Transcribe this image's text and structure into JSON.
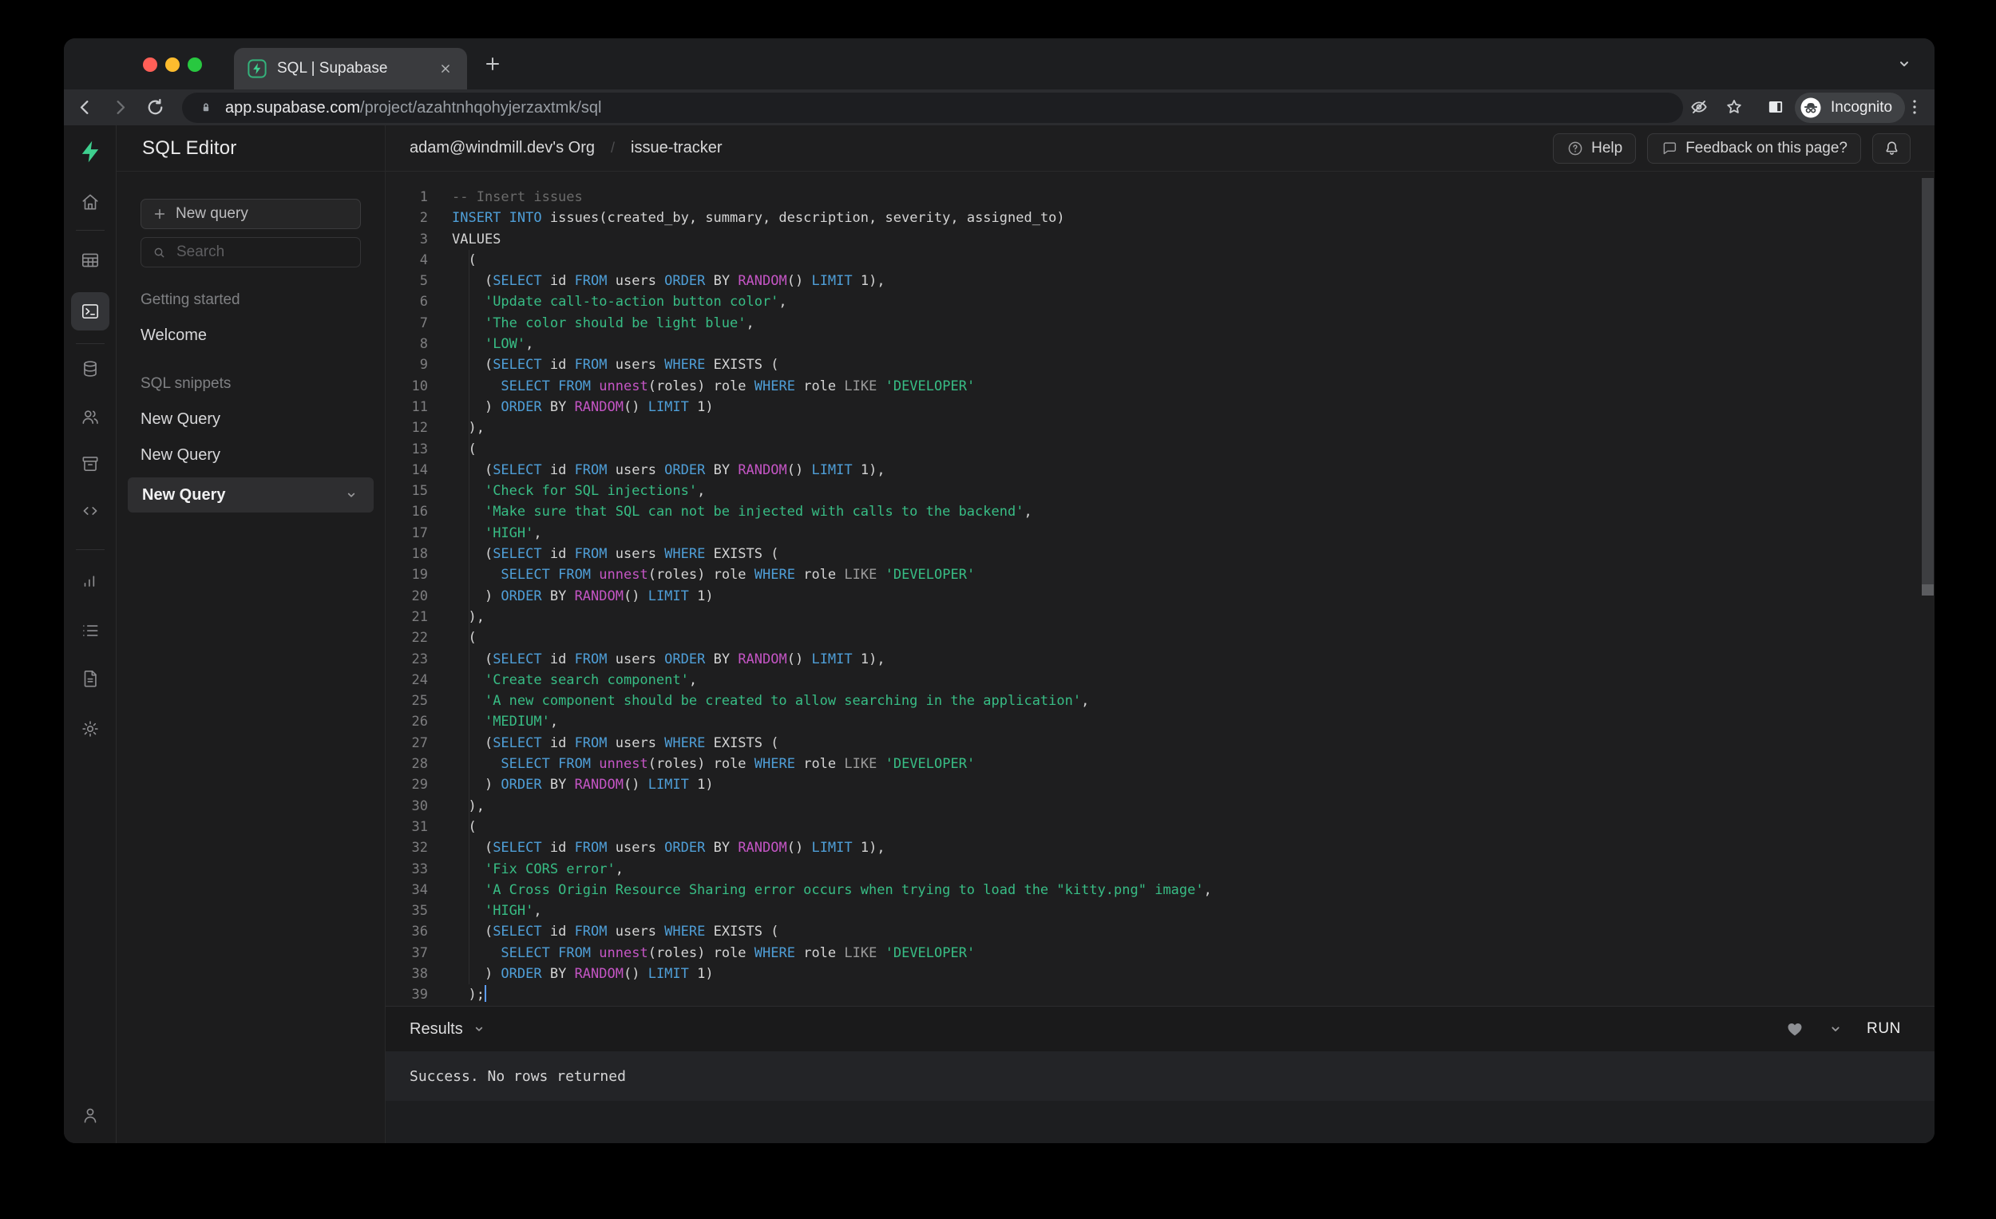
{
  "browser": {
    "tab_title": "SQL | Supabase",
    "url_host": "app.supabase.com",
    "url_path": "/project/azahtnhqohyjerzaxtmk/sql",
    "incognito_label": "Incognito"
  },
  "rail": {
    "items": [
      {
        "icon": "supabase-logo"
      },
      {
        "icon": "home"
      },
      {
        "divider": true
      },
      {
        "icon": "table-editor"
      },
      {
        "icon": "sql-editor",
        "active": true
      },
      {
        "divider": true
      },
      {
        "icon": "database"
      },
      {
        "icon": "auth-users"
      },
      {
        "icon": "storage"
      },
      {
        "icon": "edge-functions"
      },
      {
        "divider": true
      },
      {
        "icon": "reports"
      },
      {
        "icon": "logs"
      },
      {
        "icon": "api-docs"
      },
      {
        "icon": "settings"
      }
    ],
    "bottom": {
      "icon": "account"
    }
  },
  "panel": {
    "title": "SQL Editor",
    "new_query_button": "New query",
    "search_placeholder": "Search",
    "sections": [
      {
        "label": "Getting started",
        "items": [
          {
            "label": "Welcome",
            "active": false
          }
        ]
      },
      {
        "label": "SQL snippets",
        "items": [
          {
            "label": "New Query",
            "active": false
          },
          {
            "label": "New Query",
            "active": false
          },
          {
            "label": "New Query",
            "active": true
          }
        ]
      }
    ]
  },
  "header": {
    "breadcrumb_org": "adam@windmill.dev's Org",
    "breadcrumb_separator": "/",
    "breadcrumb_project": "issue-tracker",
    "help_button": "Help",
    "feedback_button": "Feedback on this page?"
  },
  "editor": {
    "cursor_line": 39,
    "lines": [
      [
        [
          "c",
          "-- Insert issues"
        ]
      ],
      [
        [
          "k",
          "INSERT"
        ],
        [
          "p",
          " "
        ],
        [
          "k",
          "INTO"
        ],
        [
          "p",
          " issues(created_by, summary, description, severity, assigned_to)"
        ]
      ],
      [
        [
          "p",
          "VALUES"
        ]
      ],
      [
        [
          "p",
          "  ("
        ]
      ],
      [
        [
          "p",
          "    ("
        ],
        [
          "k",
          "SELECT"
        ],
        [
          "p",
          " id "
        ],
        [
          "k",
          "FROM"
        ],
        [
          "p",
          " users "
        ],
        [
          "k",
          "ORDER"
        ],
        [
          "p",
          " BY "
        ],
        [
          "f",
          "RANDOM"
        ],
        [
          "p",
          "() "
        ],
        [
          "k",
          "LIMIT"
        ],
        [
          "p",
          " 1),"
        ]
      ],
      [
        [
          "p",
          "    "
        ],
        [
          "s",
          "'Update call-to-action button color'"
        ],
        [
          "p",
          ","
        ]
      ],
      [
        [
          "p",
          "    "
        ],
        [
          "s",
          "'The color should be light blue'"
        ],
        [
          "p",
          ","
        ]
      ],
      [
        [
          "p",
          "    "
        ],
        [
          "s",
          "'LOW'"
        ],
        [
          "p",
          ","
        ]
      ],
      [
        [
          "p",
          "    ("
        ],
        [
          "k",
          "SELECT"
        ],
        [
          "p",
          " id "
        ],
        [
          "k",
          "FROM"
        ],
        [
          "p",
          " users "
        ],
        [
          "k",
          "WHERE"
        ],
        [
          "p",
          " EXISTS ("
        ]
      ],
      [
        [
          "p",
          "      "
        ],
        [
          "k",
          "SELECT"
        ],
        [
          "p",
          " "
        ],
        [
          "k",
          "FROM"
        ],
        [
          "p",
          " "
        ],
        [
          "f",
          "unnest"
        ],
        [
          "p",
          "(roles) role "
        ],
        [
          "k",
          "WHERE"
        ],
        [
          "p",
          " role "
        ],
        [
          "o",
          "LIKE"
        ],
        [
          "p",
          " "
        ],
        [
          "s",
          "'DEVELOPER'"
        ]
      ],
      [
        [
          "p",
          "    ) "
        ],
        [
          "k",
          "ORDER"
        ],
        [
          "p",
          " BY "
        ],
        [
          "f",
          "RANDOM"
        ],
        [
          "p",
          "() "
        ],
        [
          "k",
          "LIMIT"
        ],
        [
          "p",
          " 1)"
        ]
      ],
      [
        [
          "p",
          "  ),"
        ]
      ],
      [
        [
          "p",
          "  ("
        ]
      ],
      [
        [
          "p",
          "    ("
        ],
        [
          "k",
          "SELECT"
        ],
        [
          "p",
          " id "
        ],
        [
          "k",
          "FROM"
        ],
        [
          "p",
          " users "
        ],
        [
          "k",
          "ORDER"
        ],
        [
          "p",
          " BY "
        ],
        [
          "f",
          "RANDOM"
        ],
        [
          "p",
          "() "
        ],
        [
          "k",
          "LIMIT"
        ],
        [
          "p",
          " 1),"
        ]
      ],
      [
        [
          "p",
          "    "
        ],
        [
          "s",
          "'Check for SQL injections'"
        ],
        [
          "p",
          ","
        ]
      ],
      [
        [
          "p",
          "    "
        ],
        [
          "s",
          "'Make sure that SQL can not be injected with calls to the backend'"
        ],
        [
          "p",
          ","
        ]
      ],
      [
        [
          "p",
          "    "
        ],
        [
          "s",
          "'HIGH'"
        ],
        [
          "p",
          ","
        ]
      ],
      [
        [
          "p",
          "    ("
        ],
        [
          "k",
          "SELECT"
        ],
        [
          "p",
          " id "
        ],
        [
          "k",
          "FROM"
        ],
        [
          "p",
          " users "
        ],
        [
          "k",
          "WHERE"
        ],
        [
          "p",
          " EXISTS ("
        ]
      ],
      [
        [
          "p",
          "      "
        ],
        [
          "k",
          "SELECT"
        ],
        [
          "p",
          " "
        ],
        [
          "k",
          "FROM"
        ],
        [
          "p",
          " "
        ],
        [
          "f",
          "unnest"
        ],
        [
          "p",
          "(roles) role "
        ],
        [
          "k",
          "WHERE"
        ],
        [
          "p",
          " role "
        ],
        [
          "o",
          "LIKE"
        ],
        [
          "p",
          " "
        ],
        [
          "s",
          "'DEVELOPER'"
        ]
      ],
      [
        [
          "p",
          "    ) "
        ],
        [
          "k",
          "ORDER"
        ],
        [
          "p",
          " BY "
        ],
        [
          "f",
          "RANDOM"
        ],
        [
          "p",
          "() "
        ],
        [
          "k",
          "LIMIT"
        ],
        [
          "p",
          " 1)"
        ]
      ],
      [
        [
          "p",
          "  ),"
        ]
      ],
      [
        [
          "p",
          "  ("
        ]
      ],
      [
        [
          "p",
          "    ("
        ],
        [
          "k",
          "SELECT"
        ],
        [
          "p",
          " id "
        ],
        [
          "k",
          "FROM"
        ],
        [
          "p",
          " users "
        ],
        [
          "k",
          "ORDER"
        ],
        [
          "p",
          " BY "
        ],
        [
          "f",
          "RANDOM"
        ],
        [
          "p",
          "() "
        ],
        [
          "k",
          "LIMIT"
        ],
        [
          "p",
          " 1),"
        ]
      ],
      [
        [
          "p",
          "    "
        ],
        [
          "s",
          "'Create search component'"
        ],
        [
          "p",
          ","
        ]
      ],
      [
        [
          "p",
          "    "
        ],
        [
          "s",
          "'A new component should be created to allow searching in the application'"
        ],
        [
          "p",
          ","
        ]
      ],
      [
        [
          "p",
          "    "
        ],
        [
          "s",
          "'MEDIUM'"
        ],
        [
          "p",
          ","
        ]
      ],
      [
        [
          "p",
          "    ("
        ],
        [
          "k",
          "SELECT"
        ],
        [
          "p",
          " id "
        ],
        [
          "k",
          "FROM"
        ],
        [
          "p",
          " users "
        ],
        [
          "k",
          "WHERE"
        ],
        [
          "p",
          " EXISTS ("
        ]
      ],
      [
        [
          "p",
          "      "
        ],
        [
          "k",
          "SELECT"
        ],
        [
          "p",
          " "
        ],
        [
          "k",
          "FROM"
        ],
        [
          "p",
          " "
        ],
        [
          "f",
          "unnest"
        ],
        [
          "p",
          "(roles) role "
        ],
        [
          "k",
          "WHERE"
        ],
        [
          "p",
          " role "
        ],
        [
          "o",
          "LIKE"
        ],
        [
          "p",
          " "
        ],
        [
          "s",
          "'DEVELOPER'"
        ]
      ],
      [
        [
          "p",
          "    ) "
        ],
        [
          "k",
          "ORDER"
        ],
        [
          "p",
          " BY "
        ],
        [
          "f",
          "RANDOM"
        ],
        [
          "p",
          "() "
        ],
        [
          "k",
          "LIMIT"
        ],
        [
          "p",
          " 1)"
        ]
      ],
      [
        [
          "p",
          "  ),"
        ]
      ],
      [
        [
          "p",
          "  ("
        ]
      ],
      [
        [
          "p",
          "    ("
        ],
        [
          "k",
          "SELECT"
        ],
        [
          "p",
          " id "
        ],
        [
          "k",
          "FROM"
        ],
        [
          "p",
          " users "
        ],
        [
          "k",
          "ORDER"
        ],
        [
          "p",
          " BY "
        ],
        [
          "f",
          "RANDOM"
        ],
        [
          "p",
          "() "
        ],
        [
          "k",
          "LIMIT"
        ],
        [
          "p",
          " 1),"
        ]
      ],
      [
        [
          "p",
          "    "
        ],
        [
          "s",
          "'Fix CORS error'"
        ],
        [
          "p",
          ","
        ]
      ],
      [
        [
          "p",
          "    "
        ],
        [
          "s",
          "'A Cross Origin Resource Sharing error occurs when trying to load the \"kitty.png\" image'"
        ],
        [
          "p",
          ","
        ]
      ],
      [
        [
          "p",
          "    "
        ],
        [
          "s",
          "'HIGH'"
        ],
        [
          "p",
          ","
        ]
      ],
      [
        [
          "p",
          "    ("
        ],
        [
          "k",
          "SELECT"
        ],
        [
          "p",
          " id "
        ],
        [
          "k",
          "FROM"
        ],
        [
          "p",
          " users "
        ],
        [
          "k",
          "WHERE"
        ],
        [
          "p",
          " EXISTS ("
        ]
      ],
      [
        [
          "p",
          "      "
        ],
        [
          "k",
          "SELECT"
        ],
        [
          "p",
          " "
        ],
        [
          "k",
          "FROM"
        ],
        [
          "p",
          " "
        ],
        [
          "f",
          "unnest"
        ],
        [
          "p",
          "(roles) role "
        ],
        [
          "k",
          "WHERE"
        ],
        [
          "p",
          " role "
        ],
        [
          "o",
          "LIKE"
        ],
        [
          "p",
          " "
        ],
        [
          "s",
          "'DEVELOPER'"
        ]
      ],
      [
        [
          "p",
          "    ) "
        ],
        [
          "k",
          "ORDER"
        ],
        [
          "p",
          " BY "
        ],
        [
          "f",
          "RANDOM"
        ],
        [
          "p",
          "() "
        ],
        [
          "k",
          "LIMIT"
        ],
        [
          "p",
          " 1)"
        ]
      ],
      [
        [
          "p",
          "  );"
        ]
      ]
    ]
  },
  "results": {
    "label": "Results",
    "run_button": "RUN",
    "message": "Success. No rows returned"
  },
  "colors": {
    "accent_green": "#3ECF8E",
    "keyword": "#4F9FD8",
    "function": "#C455C4",
    "string": "#38BD85",
    "operator": "#9B9B9B",
    "comment": "#6B6B6B",
    "text": "#D4D4D4",
    "traffic_red": "#FF5F57",
    "traffic_yellow": "#FEBC2E",
    "traffic_green": "#28C840"
  }
}
